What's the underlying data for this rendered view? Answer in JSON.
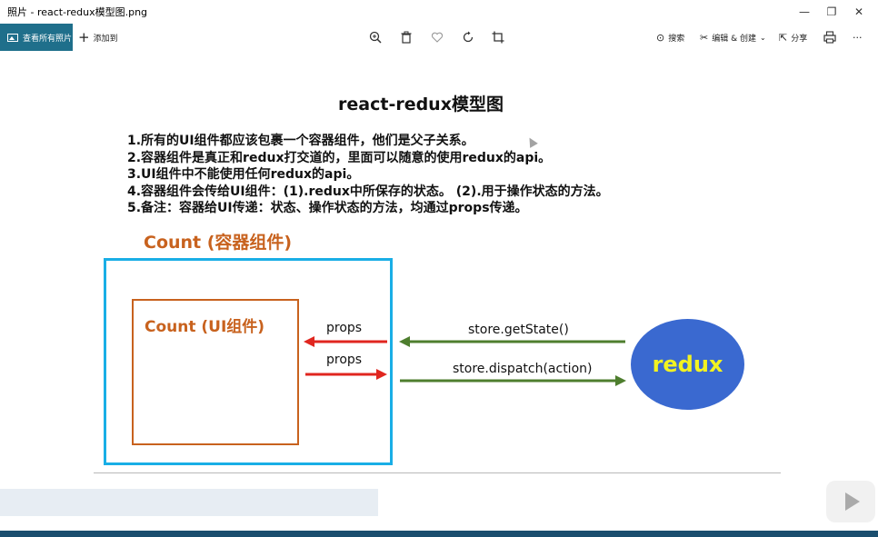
{
  "window": {
    "title": "照片 - react-redux模型图.png",
    "minimize": "—",
    "restore": "❐",
    "close": "✕"
  },
  "toolbar": {
    "view_all": "查看所有照片",
    "add_to": "添加到",
    "search": "搜索",
    "edit_create": "编辑 & 创建",
    "share": "分享",
    "more": "···"
  },
  "slide": {
    "title": "react-redux模型图",
    "notes": [
      "1.所有的UI组件都应该包裹一个容器组件，他们是父子关系。",
      "2.容器组件是真正和redux打交道的，里面可以随意的使用redux的api。",
      "3.UI组件中不能使用任何redux的api。",
      "4.容器组件会传给UI组件：(1).redux中所保存的状态。 (2).用于操作状态的方法。",
      "5.备注：容器给UI传递：状态、操作状态的方法，均通过props传递。"
    ],
    "container_label": "Count (容器组件)",
    "ui_label": "Count (UI组件)",
    "props_top": "props",
    "props_bottom": "props",
    "get_state": "store.getState()",
    "dispatch": "store.dispatch(action)",
    "redux": "redux"
  },
  "colors": {
    "container_border": "#19aee6",
    "ui_border": "#c8621e",
    "red_arrow": "#e0261f",
    "green_arrow": "#4e7e2e",
    "redux_fill": "#3a69d0",
    "redux_text": "#f2f221"
  },
  "player": {
    "progress_fraction": 0.0
  }
}
